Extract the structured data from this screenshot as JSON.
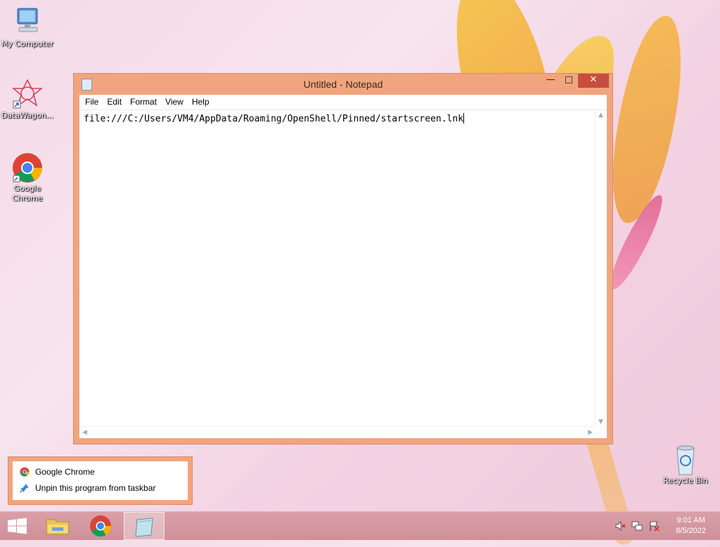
{
  "desktop": {
    "icons": [
      {
        "label": "My Computer"
      },
      {
        "label": "DataWagon..."
      },
      {
        "label": "Google Chrome"
      },
      {
        "label": "Recycle Bin"
      }
    ]
  },
  "window": {
    "title": "Untitled - Notepad",
    "controls": {
      "minimize": "—",
      "maximize": "□",
      "close": "✕"
    },
    "menu": [
      "File",
      "Edit",
      "Format",
      "View",
      "Help"
    ],
    "content": "file:///C:/Users/VM4/AppData/Roaming/OpenShell/Pinned/startscreen.lnk"
  },
  "jumplist": {
    "items": [
      {
        "label": "Google Chrome",
        "icon": "chrome-icon"
      },
      {
        "label": "Unpin this program from taskbar",
        "icon": "unpin-icon"
      }
    ]
  },
  "taskbar": {
    "clock": {
      "time": "9:01 AM",
      "date": "8/5/2022"
    }
  },
  "colors": {
    "window_frame": "#f0a57f",
    "close_button": "#c74e3e",
    "taskbar": "#cf8f99"
  }
}
